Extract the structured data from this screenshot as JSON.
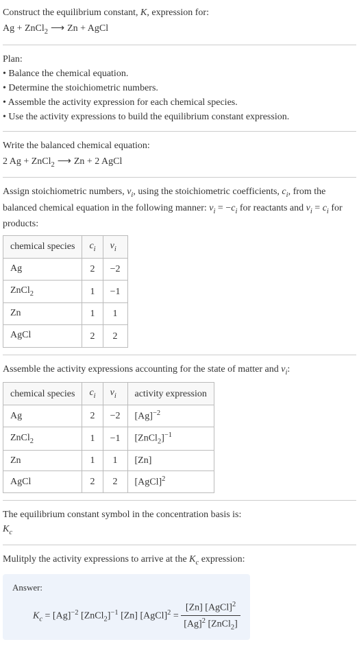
{
  "prompt": {
    "line1": "Construct the equilibrium constant, K, expression for:",
    "eq_lhs": "Ag + ZnCl",
    "eq_sub1": "2",
    "eq_arrow": "⟶",
    "eq_rhs": "Zn + AgCl"
  },
  "plan": {
    "heading": "Plan:",
    "items": [
      "Balance the chemical equation.",
      "Determine the stoichiometric numbers.",
      "Assemble the activity expression for each chemical species.",
      "Use the activity expressions to build the equilibrium constant expression."
    ]
  },
  "balanced": {
    "intro": "Write the balanced chemical equation:",
    "eq_part1": "2 Ag + ZnCl",
    "eq_sub1": "2",
    "eq_arrow": "⟶",
    "eq_part2": "Zn + 2 AgCl"
  },
  "assign": {
    "intro_a": "Assign stoichiometric numbers, ",
    "nu_i": "ν",
    "nu_sub": "i",
    "intro_b": ", using the stoichiometric coefficients, ",
    "c_i": "c",
    "c_sub": "i",
    "intro_c": ", from the balanced chemical equation in the following manner: ",
    "rel1_a": "ν",
    "rel1_b": "i",
    "rel1_c": " = −",
    "rel1_d": "c",
    "rel1_e": "i",
    "rel_text": " for reactants and ",
    "rel2_a": "ν",
    "rel2_b": "i",
    "rel2_c": " = ",
    "rel2_d": "c",
    "rel2_e": "i",
    "rel_text2": " for products:"
  },
  "table1": {
    "h1": "chemical species",
    "h2_a": "c",
    "h2_b": "i",
    "h3_a": "ν",
    "h3_b": "i",
    "rows": [
      {
        "species_a": "Ag",
        "species_b": "",
        "c": "2",
        "nu": "−2"
      },
      {
        "species_a": "ZnCl",
        "species_b": "2",
        "c": "1",
        "nu": "−1"
      },
      {
        "species_a": "Zn",
        "species_b": "",
        "c": "1",
        "nu": "1"
      },
      {
        "species_a": "AgCl",
        "species_b": "",
        "c": "2",
        "nu": "2"
      }
    ]
  },
  "assemble": {
    "intro_a": "Assemble the activity expressions accounting for the state of matter and ",
    "nu": "ν",
    "nu_sub": "i",
    "intro_b": ":"
  },
  "table2": {
    "h1": "chemical species",
    "h2_a": "c",
    "h2_b": "i",
    "h3_a": "ν",
    "h3_b": "i",
    "h4": "activity expression",
    "rows": [
      {
        "species_a": "Ag",
        "species_b": "",
        "c": "2",
        "nu": "−2",
        "act_a": "[Ag]",
        "act_sup": "−2",
        "act_sub": ""
      },
      {
        "species_a": "ZnCl",
        "species_b": "2",
        "c": "1",
        "nu": "−1",
        "act_a": "[ZnCl",
        "act_sub": "2",
        "act_b": "]",
        "act_sup": "−1"
      },
      {
        "species_a": "Zn",
        "species_b": "",
        "c": "1",
        "nu": "1",
        "act_a": "[Zn]",
        "act_sup": "",
        "act_sub": ""
      },
      {
        "species_a": "AgCl",
        "species_b": "",
        "c": "2",
        "nu": "2",
        "act_a": "[AgCl]",
        "act_sup": "2",
        "act_sub": ""
      }
    ]
  },
  "kcbasis": {
    "intro": "The equilibrium constant symbol in the concentration basis is:",
    "k": "K",
    "c": "c"
  },
  "multiply": {
    "intro_a": "Mulitply the activity expressions to arrive at the ",
    "k": "K",
    "c": "c",
    "intro_b": " expression:"
  },
  "answer": {
    "label": "Answer:",
    "lhs_k": "K",
    "lhs_c": "c",
    "eq": " = ",
    "t1": "[Ag]",
    "t1s": "−2",
    "t2a": " [ZnCl",
    "t2sub": "2",
    "t2b": "]",
    "t2s": "−1",
    "t3": " [Zn] [AgCl]",
    "t3s": "2",
    "eq2": " = ",
    "num_a": "[Zn] [AgCl]",
    "num_s": "2",
    "den_a": "[Ag]",
    "den_s": "2",
    "den_b": " [ZnCl",
    "den_sub": "2",
    "den_c": "]"
  }
}
